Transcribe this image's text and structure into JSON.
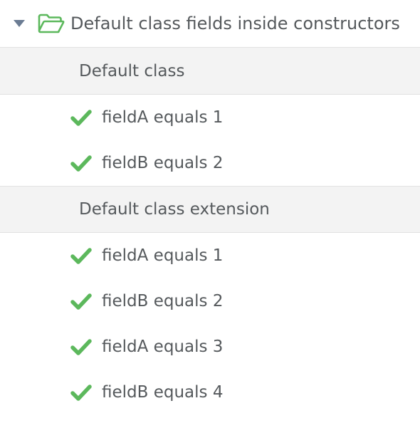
{
  "suite": {
    "title": "Default class fields inside constructors",
    "expanded": true,
    "icon": "folder-open-icon",
    "icon_color": "#5cb85c"
  },
  "groups": [
    {
      "title": "Default class",
      "tests": [
        {
          "title": "fieldA equals 1",
          "status": "passed"
        },
        {
          "title": "fieldB equals 2",
          "status": "passed"
        }
      ]
    },
    {
      "title": "Default class extension",
      "tests": [
        {
          "title": "fieldA equals 1",
          "status": "passed"
        },
        {
          "title": "fieldB equals 2",
          "status": "passed"
        },
        {
          "title": "fieldA equals 3",
          "status": "passed"
        },
        {
          "title": "fieldB equals 4",
          "status": "passed"
        }
      ]
    }
  ],
  "colors": {
    "pass": "#5cb85c",
    "group_bg": "#f3f3f3",
    "text": "#55595c",
    "caret": "#6b7c93"
  }
}
